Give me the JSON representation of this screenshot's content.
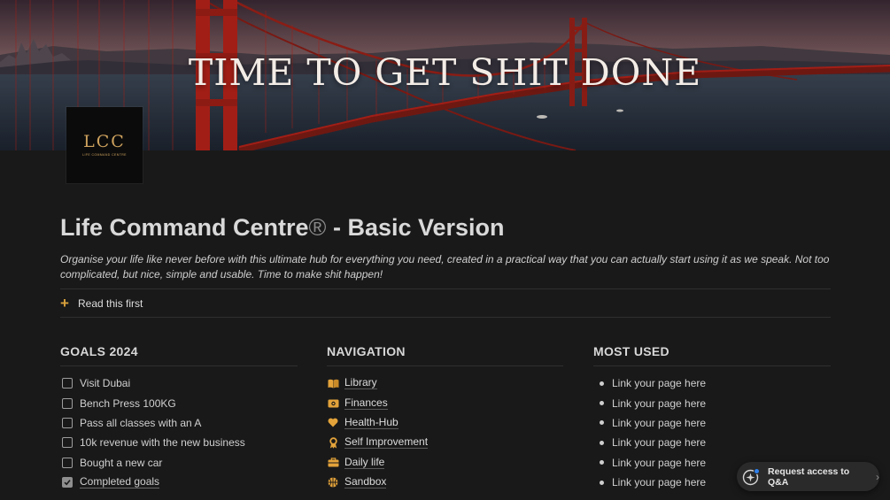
{
  "cover": {
    "title": "TIME TO GET SHIT DONE"
  },
  "logo": {
    "mark": "LCC",
    "subtitle": "LIFE COMMAND CENTRE"
  },
  "page": {
    "title": "Life Command Centre",
    "registered": "®",
    "title_suffix": " - Basic Version",
    "description": "Organise your life like never before with this ultimate hub for everything you need, created in a practical way that you can actually start using it as we speak. Not too complicated, but nice, simple and usable. Time to make shit happen!",
    "toggle_label": "Read this first"
  },
  "goals": {
    "title": "GOALS 2024",
    "items": [
      {
        "label": "Visit Dubai",
        "checked": false
      },
      {
        "label": "Bench Press 100KG",
        "checked": false
      },
      {
        "label": "Pass all classes with an A",
        "checked": false
      },
      {
        "label": "10k revenue with the new business",
        "checked": false
      },
      {
        "label": "Bought a new car",
        "checked": false
      },
      {
        "label": "Completed goals",
        "checked": true
      }
    ]
  },
  "navigation": {
    "title": "NAVIGATION",
    "items": [
      {
        "label": "Library",
        "icon": "book-icon"
      },
      {
        "label": "Finances",
        "icon": "money-icon"
      },
      {
        "label": "Health-Hub",
        "icon": "heart-icon"
      },
      {
        "label": "Self Improvement",
        "icon": "ribbon-icon"
      },
      {
        "label": "Daily life",
        "icon": "briefcase-icon"
      },
      {
        "label": "Sandbox",
        "icon": "basketball-icon"
      }
    ]
  },
  "most_used": {
    "title": "MOST USED",
    "items": [
      {
        "label": "Link your page here"
      },
      {
        "label": "Link your page here"
      },
      {
        "label": "Link your page here"
      },
      {
        "label": "Link your page here"
      },
      {
        "label": "Link your page here"
      },
      {
        "label": "Link your page here"
      }
    ]
  },
  "qa_button": {
    "label": "Request access to Q&A"
  },
  "colors": {
    "background": "#191919",
    "accent": "#d9a23c",
    "bridge": "#b8231a"
  }
}
